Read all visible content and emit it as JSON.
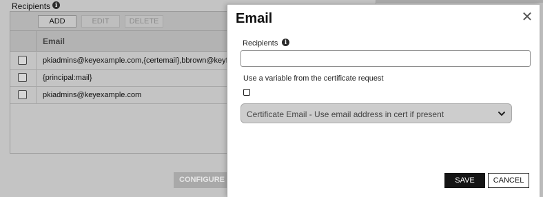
{
  "background": {
    "recipients_label": "Recipients",
    "toolbar": {
      "add": "ADD",
      "edit": "EDIT",
      "delete": "DELETE"
    },
    "table": {
      "column_header": "Email",
      "rows": [
        "pkiadmins@keyexample.com,{certemail},bbrown@keyfa",
        "{principal:mail}",
        "pkiadmins@keyexample.com"
      ]
    },
    "configure_button": "CONFIGURE W"
  },
  "modal": {
    "title": "Email",
    "close_icon": "✕",
    "recipients_label": "Recipients",
    "recipients_value": "",
    "variable_label": "Use a variable from the certificate request",
    "variable_checked": false,
    "select_value": "Certificate Email - Use email address in cert if present",
    "save": "SAVE",
    "cancel": "CANCEL"
  },
  "icons": {
    "info": "info-icon",
    "close": "close-icon",
    "chevron": "chevron-down-icon"
  },
  "colors": {
    "overlay": "#c4c4c4",
    "save_bg": "#151515",
    "select_bg": "#cdcdcd"
  }
}
